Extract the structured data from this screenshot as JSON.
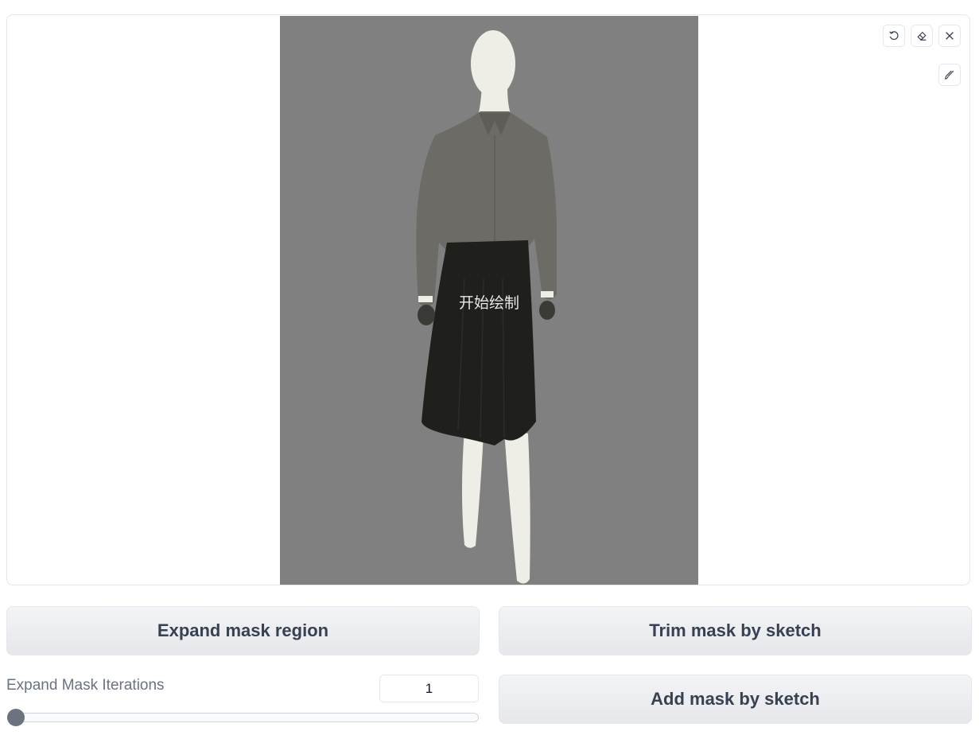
{
  "canvas": {
    "overlay_text": "开始绘制",
    "background_color": "#808080"
  },
  "toolbar": {
    "icons": [
      "undo-icon",
      "eraser-icon",
      "close-icon",
      "brush-icon"
    ]
  },
  "buttons": {
    "expand_mask": "Expand mask region",
    "trim_mask": "Trim mask by sketch",
    "add_mask": "Add mask by sketch"
  },
  "slider": {
    "label": "Expand Mask Iterations",
    "value": "1",
    "fraction": 0
  }
}
